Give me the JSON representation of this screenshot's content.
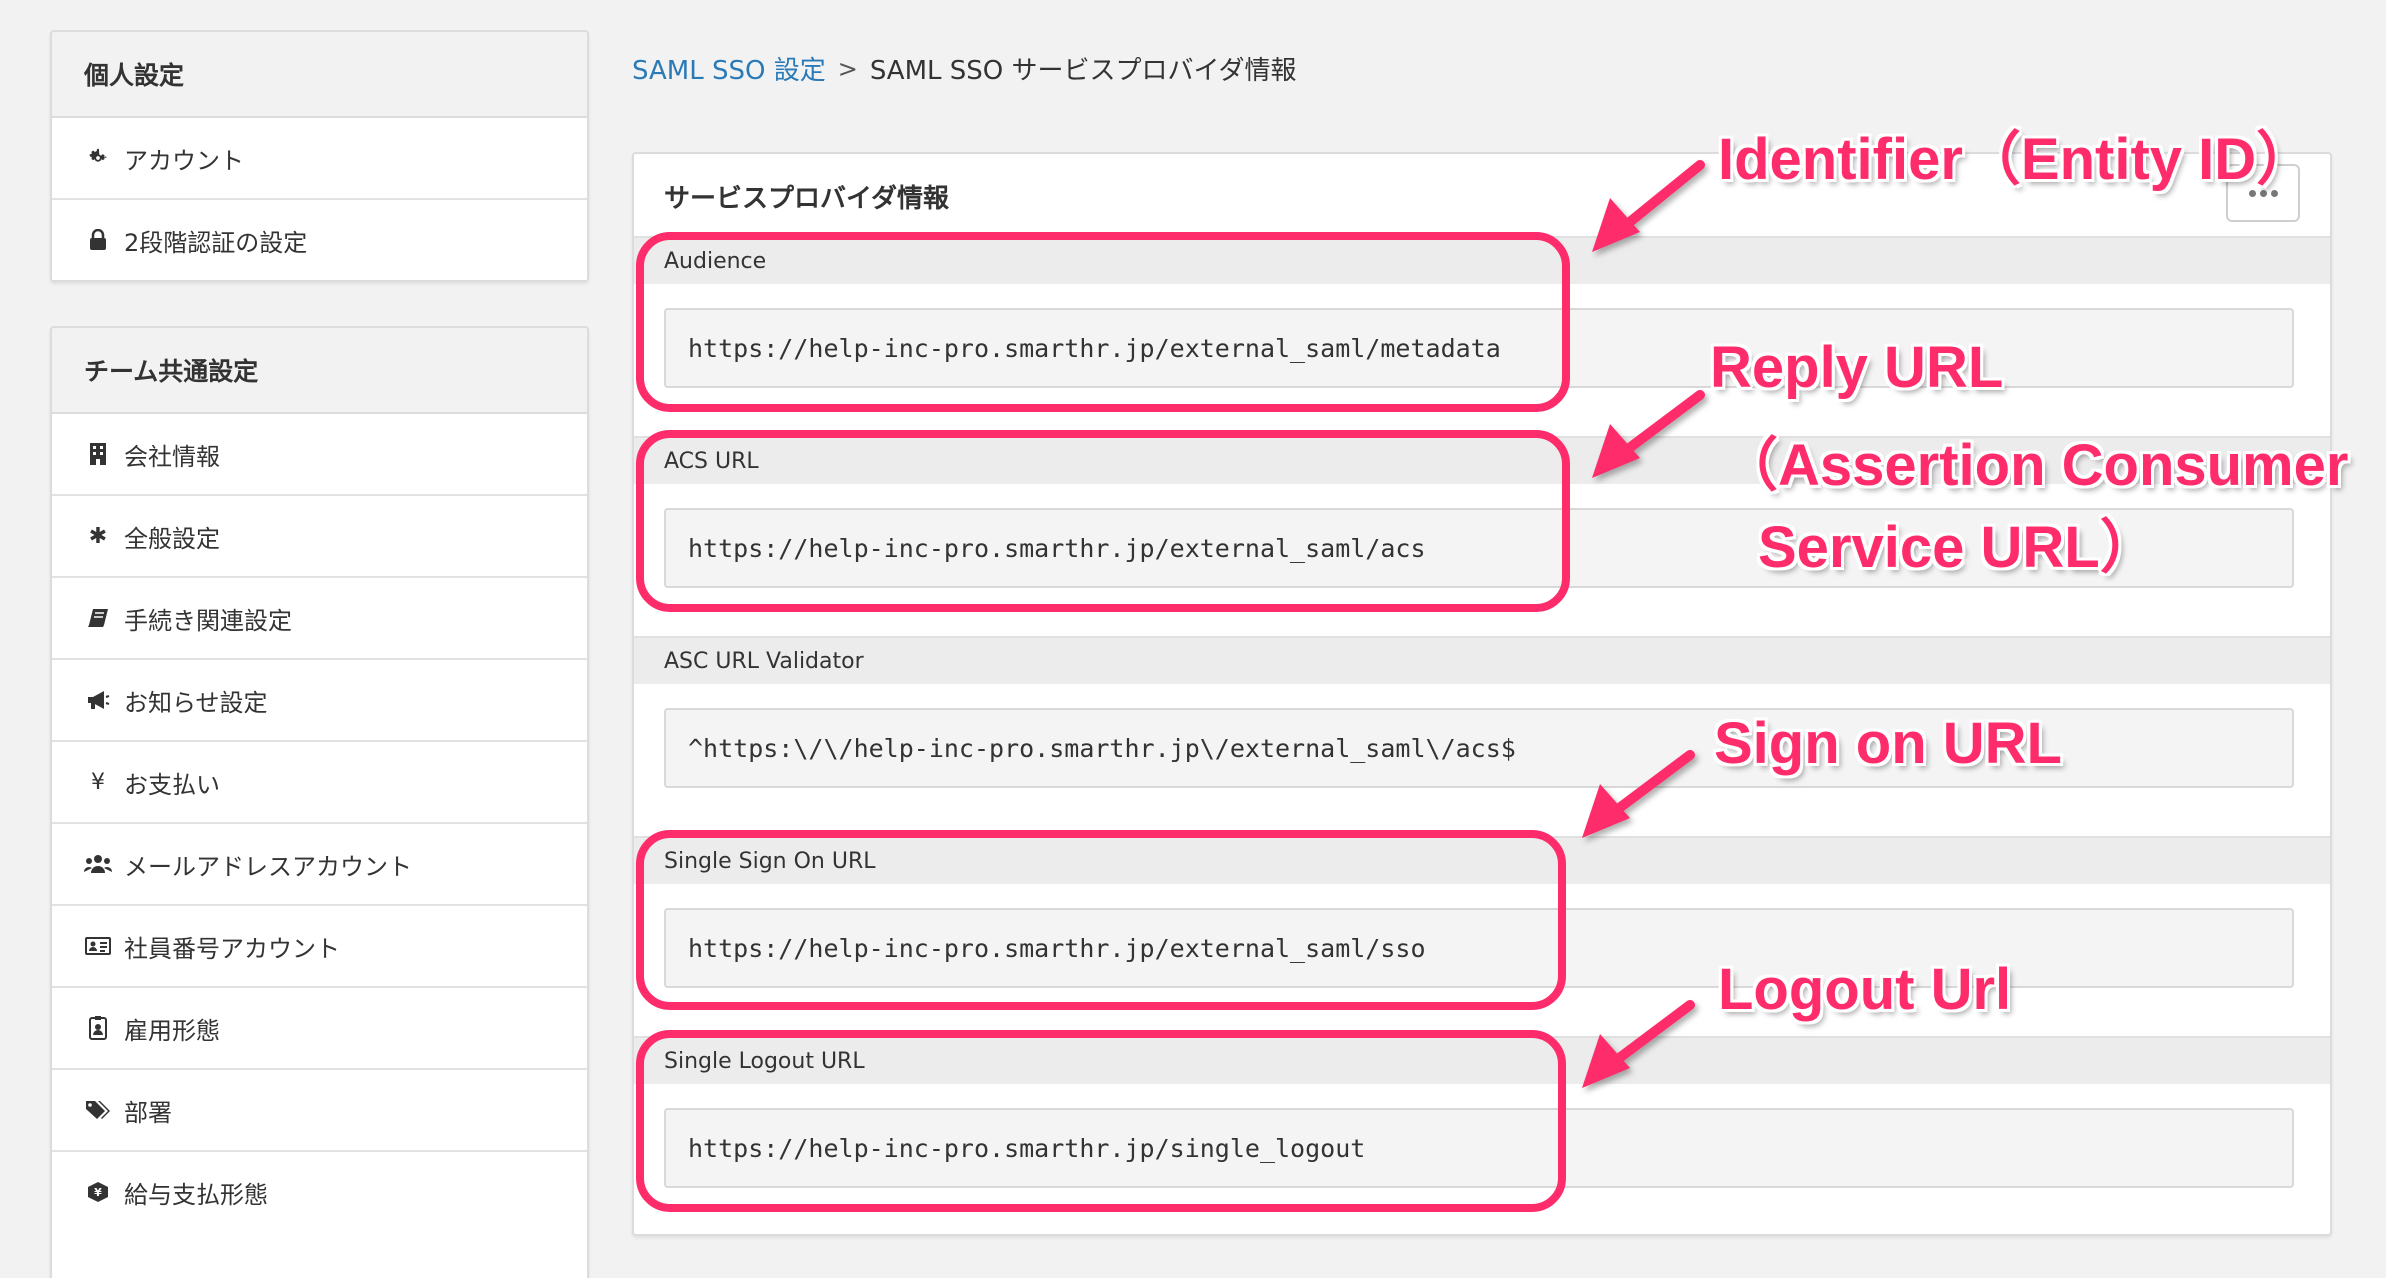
{
  "sidebar": {
    "personal": {
      "title": "個人設定",
      "items": [
        {
          "label": "アカウント",
          "icon": "gear-icon"
        },
        {
          "label": "2段階認証の設定",
          "icon": "lock-icon"
        }
      ]
    },
    "team": {
      "title": "チーム共通設定",
      "items": [
        {
          "label": "会社情報",
          "icon": "building-icon"
        },
        {
          "label": "全般設定",
          "icon": "asterisk-icon"
        },
        {
          "label": "手続き関連設定",
          "icon": "book-icon"
        },
        {
          "label": "お知らせ設定",
          "icon": "megaphone-icon"
        },
        {
          "label": "お支払い",
          "icon": "yen-icon"
        },
        {
          "label": "メールアドレスアカウント",
          "icon": "users-icon"
        },
        {
          "label": "社員番号アカウント",
          "icon": "id-card-icon"
        },
        {
          "label": "雇用形態",
          "icon": "id-badge-icon"
        },
        {
          "label": "部署",
          "icon": "tags-icon"
        },
        {
          "label": "給与支払形態",
          "icon": "money-icon"
        }
      ]
    }
  },
  "breadcrumb": {
    "parent": "SAML SSO 設定",
    "separator": ">",
    "current": "SAML SSO サービスプロバイダ情報"
  },
  "panel": {
    "title": "サービスプロバイダ情報",
    "more_button": "more-options",
    "fields": [
      {
        "label": "Audience",
        "value": "https://help-inc-pro.smarthr.jp/external_saml/metadata"
      },
      {
        "label": "ACS URL",
        "value": "https://help-inc-pro.smarthr.jp/external_saml/acs"
      },
      {
        "label": "ASC URL Validator",
        "value": "^https:\\/\\/help-inc-pro.smarthr.jp\\/external_saml\\/acs$"
      },
      {
        "label": "Single Sign On URL",
        "value": "https://help-inc-pro.smarthr.jp/external_saml/sso"
      },
      {
        "label": "Single Logout URL",
        "value": "https://help-inc-pro.smarthr.jp/single_logout"
      }
    ]
  },
  "annotations": {
    "identifier": "Identifier（Entity ID）",
    "reply_line1": "Reply URL",
    "reply_line2": "（Assertion Consumer",
    "reply_line3": "Service URL）",
    "sign_on": "Sign on URL",
    "logout": "Logout Url",
    "color": "#ff2c6c"
  },
  "colors": {
    "link": "#2a7ab8",
    "highlight": "#ff2c6c"
  }
}
